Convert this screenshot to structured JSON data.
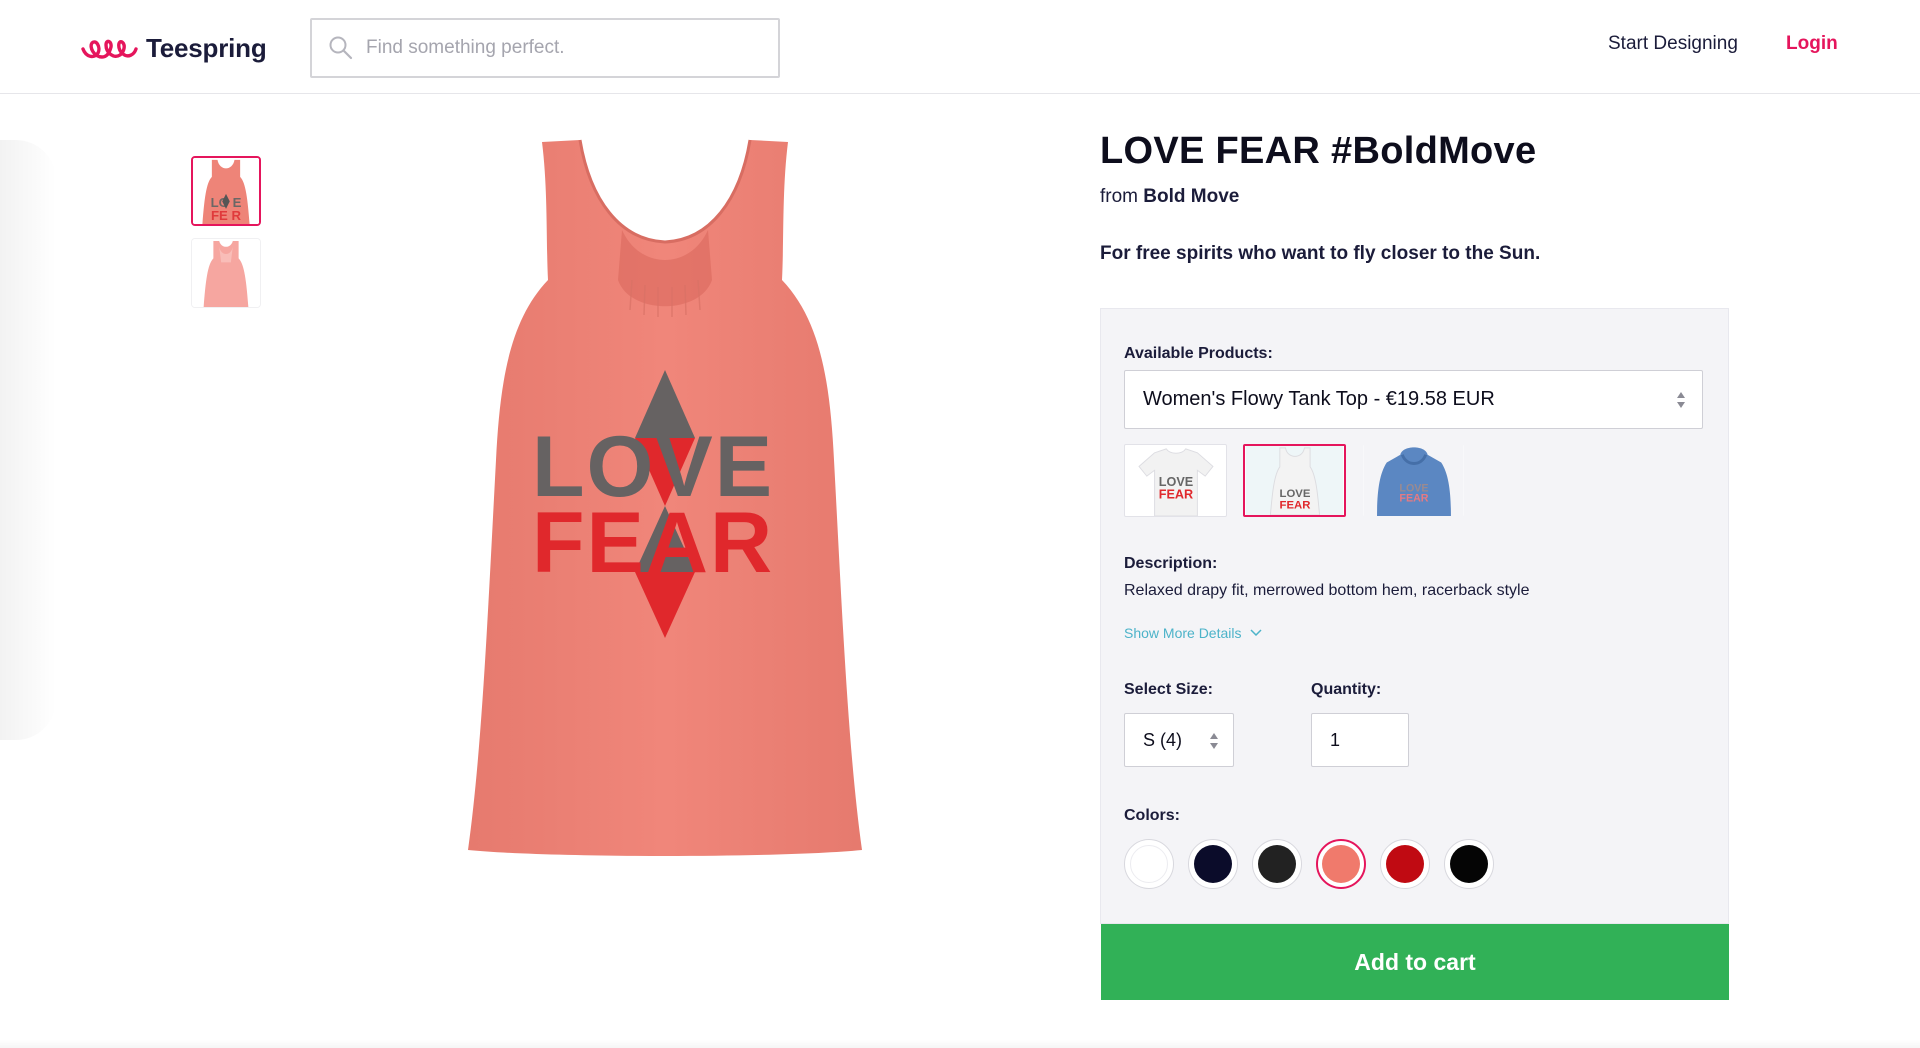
{
  "header": {
    "logo_text": "Teespring",
    "search_placeholder": "Find something perfect.",
    "nav": {
      "start_designing": "Start Designing",
      "login": "Login"
    }
  },
  "gallery": {
    "thumbnails": [
      "front-view",
      "back-view"
    ],
    "active_thumbnail": 0
  },
  "product": {
    "title": "LOVE FEAR #BoldMove",
    "from_label": "from",
    "store_name": "Bold Move",
    "tagline": "For free spirits who want to fly closer to the Sun.",
    "design_text": {
      "line1": "LOVE",
      "line2": "FEAR"
    }
  },
  "panel": {
    "available_products_label": "Available Products:",
    "selected_product": "Women's Flowy Tank Top - €19.58 EUR",
    "product_thumbs": [
      "t-shirt",
      "tank-top",
      "hoodie"
    ],
    "active_product_thumb": 1,
    "description_label": "Description:",
    "description_text": "Relaxed drapy fit, merrowed bottom hem, racerback style",
    "show_more_label": "Show More Details",
    "size_label": "Select Size:",
    "size_value": "S (4)",
    "quantity_label": "Quantity:",
    "quantity_value": "1",
    "colors_label": "Colors:",
    "colors": [
      "#ffffff",
      "#0b0c2a",
      "#222222",
      "#f07a6c",
      "#c00a12",
      "#050505"
    ],
    "active_color": 3,
    "add_to_cart": "Add to cart"
  },
  "theme": {
    "accent": "#e5155c",
    "cart_green": "#31b157",
    "link_teal": "#4cb3c9",
    "shirt_coral": "#ee8478"
  }
}
